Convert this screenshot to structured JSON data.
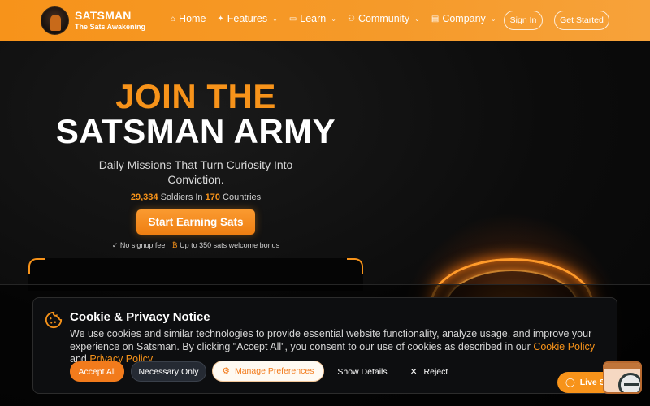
{
  "header": {
    "brand_name": "SATSMAN",
    "brand_tagline": "The Sats Awakening",
    "nav": [
      {
        "label": "Home",
        "icon": "home-icon",
        "has_dropdown": false
      },
      {
        "label": "Features",
        "icon": "sparkle-icon",
        "has_dropdown": true
      },
      {
        "label": "Learn",
        "icon": "book-icon",
        "has_dropdown": true
      },
      {
        "label": "Community",
        "icon": "users-icon",
        "has_dropdown": true
      },
      {
        "label": "Company",
        "icon": "building-icon",
        "has_dropdown": true
      }
    ],
    "sign_in_label": "Sign In",
    "get_started_label": "Get Started"
  },
  "hero": {
    "title_line1": "JOIN THE",
    "title_line2": "SATSMAN ARMY",
    "subtitle": "Daily Missions That Turn Curiosity Into Conviction.",
    "soldiers_count": "29,334",
    "soldiers_text": "Soldiers In",
    "countries_count": "170",
    "countries_text": "Countries",
    "cta_label": "Start Earning Sats",
    "perk_1": "No signup fee",
    "perk_2": "Up to 350 sats welcome bonus"
  },
  "cookie": {
    "title": "Cookie & Privacy Notice",
    "text_part1": "We use cookies and similar technologies to provide essential website functionality, analyze usage, and improve your experience on Satsman. By clicking \"Accept All\", you consent to our use of cookies as described in our",
    "cookie_policy_link": "Cookie Policy",
    "text_and": "and",
    "privacy_policy_link": "Privacy Policy",
    "text_end": ".",
    "accept_label": "Accept All",
    "necessary_label": "Necessary Only",
    "manage_label": "Manage Preferences",
    "details_label": "Show Details",
    "reject_label": "Reject"
  },
  "support": {
    "live_label": "Live Support"
  },
  "colors": {
    "brand_orange": "#f7931a",
    "dark_bg": "#0a0a0a"
  }
}
